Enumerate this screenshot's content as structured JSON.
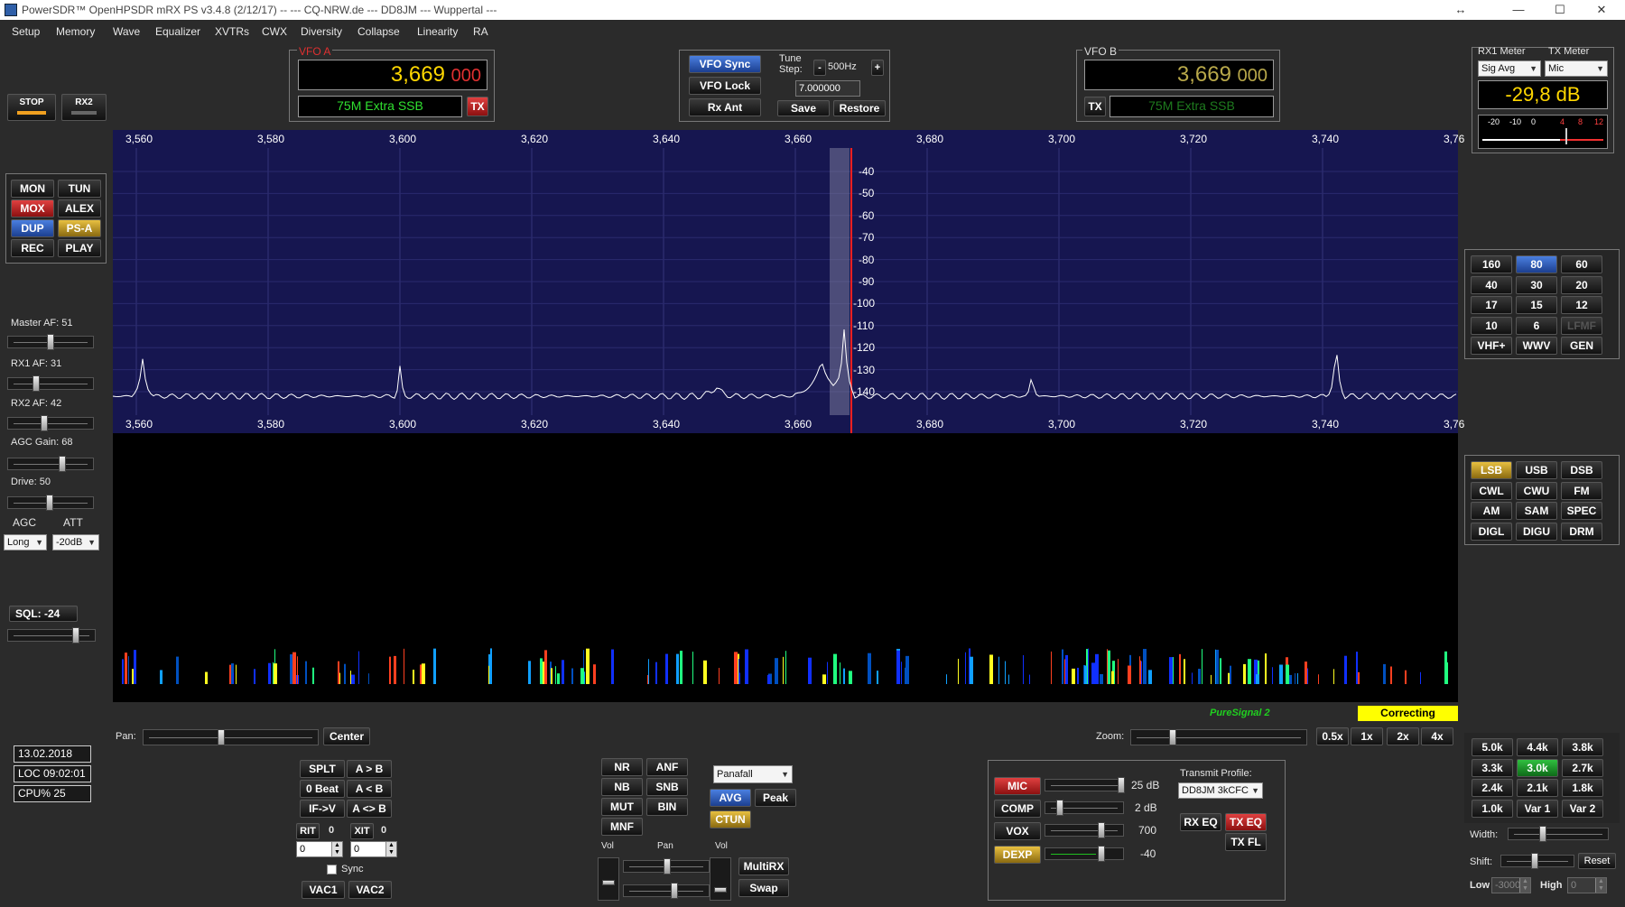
{
  "window": {
    "title": "PowerSDR™ OpenHPSDR mRX PS v3.4.8 (2/12/17)  --  ---  CQ-NRW.de  ---  DD8JM  ---  Wuppertal  ---",
    "restore_icon": "↔",
    "min": "—",
    "max": "☐",
    "close": "✕"
  },
  "menu": [
    "Setup",
    "Memory",
    "Wave",
    "Equalizer",
    "XVTRs",
    "CWX",
    "Diversity",
    "Collapse",
    "Linearity",
    "RA"
  ],
  "power": {
    "stop": "STOP",
    "rx2": "RX2"
  },
  "func_buttons": [
    {
      "label": "MON",
      "style": ""
    },
    {
      "label": "TUN",
      "style": ""
    },
    {
      "label": "MOX",
      "style": "red"
    },
    {
      "label": "ALEX",
      "style": ""
    },
    {
      "label": "DUP",
      "style": "blue"
    },
    {
      "label": "PS-A",
      "style": "gold"
    },
    {
      "label": "REC",
      "style": ""
    },
    {
      "label": "PLAY",
      "style": ""
    }
  ],
  "left": {
    "master_af": "Master AF:  51",
    "rx1_af": "RX1 AF:  31",
    "rx2_af": "RX2 AF:  42",
    "agc_gain": "AGC Gain:  68",
    "drive": "Drive:  50",
    "agc": "AGC",
    "att": "ATT",
    "agc_value": "Long",
    "att_value": "-20dB",
    "sql": "SQL:  -24"
  },
  "levels": {
    "master_af": 51,
    "rx1_af": 31,
    "rx2_af": 42,
    "agc_gain": 68,
    "drive": 50
  },
  "vfoa": {
    "title": "VFO A",
    "freq": "3,669",
    "freq_sub": "000",
    "band": "75M Extra SSB",
    "tx": "TX"
  },
  "vfob": {
    "title": "VFO B",
    "freq": "3,669",
    "freq_sub": "000",
    "band": "75M Extra SSB",
    "tx": "TX"
  },
  "tune": {
    "vfo_sync": "VFO Sync",
    "vfo_lock": "VFO Lock",
    "rx_ant": "Rx Ant",
    "tune_step_label": "Tune Step:",
    "minus": "-",
    "plus": "+",
    "step": "500Hz",
    "freq": "7.000000",
    "save": "Save",
    "restore": "Restore"
  },
  "meter": {
    "rx1_label": "RX1 Meter",
    "tx_label": "TX Meter",
    "rx1_mode": "Sig Avg",
    "tx_mode": "Mic",
    "value": "-29,8 dB",
    "scale": [
      "-20",
      "-10",
      "0",
      "4",
      "8",
      "12"
    ]
  },
  "spectrum": {
    "freq_labels": [
      "3,560",
      "3,580",
      "3,600",
      "3,620",
      "3,640",
      "3,660",
      "3,680",
      "3,700",
      "3,720",
      "3,740",
      "3,76"
    ],
    "db_labels": [
      "-40",
      "-50",
      "-60",
      "-70",
      "-80",
      "-90",
      "-100",
      "-110",
      "-120",
      "-130",
      "-140"
    ]
  },
  "waterfall": {
    "puresignal": "PureSignal 2",
    "correcting": "Correcting"
  },
  "bands": [
    "160",
    "80",
    "60",
    "40",
    "30",
    "20",
    "17",
    "15",
    "12",
    "10",
    "6",
    "LFMF",
    "VHF+",
    "WWV",
    "GEN"
  ],
  "modes": [
    "LSB",
    "USB",
    "DSB",
    "CWL",
    "CWU",
    "FM",
    "AM",
    "SAM",
    "SPEC",
    "DIGL",
    "DIGU",
    "DRM"
  ],
  "filters": [
    "5.0k",
    "4.4k",
    "3.8k",
    "3.3k",
    "3.0k",
    "2.7k",
    "2.4k",
    "2.1k",
    "1.8k",
    "1.0k",
    "Var 1",
    "Var 2"
  ],
  "filter_ctrl": {
    "width": "Width:",
    "shift": "Shift:",
    "reset": "Reset",
    "low": "Low",
    "low_val": "-3000",
    "high": "High",
    "high_val": "0"
  },
  "pan": {
    "pan": "Pan:",
    "center": "Center",
    "zoom": "Zoom:",
    "zooms": [
      "0.5x",
      "1x",
      "2x",
      "4x"
    ]
  },
  "status": {
    "date": "13.02.2018",
    "time": "LOC 09:02:01",
    "cpu": "CPU%  25"
  },
  "split": {
    "splt": "SPLT",
    "a2b": "A > B",
    "zero_beat": "0 Beat",
    "b2a": "A < B",
    "if_v": "IF->V",
    "swap": "A <> B",
    "rit": "RIT",
    "rit_v": "0",
    "xit": "XIT",
    "xit_v": "0",
    "rit_val": "0",
    "xit_val": "0",
    "sync": "Sync",
    "vac1": "VAC1",
    "vac2": "VAC2"
  },
  "dsp": {
    "buttons": [
      "NR",
      "ANF",
      "NB",
      "SNB",
      "MUT",
      "BIN",
      "MNF"
    ],
    "display": "Panafall",
    "avg": "AVG",
    "peak": "Peak",
    "ctun": "CTUN",
    "vol": "Vol",
    "pan": "Pan",
    "vol2": "Vol",
    "multirx": "MultiRX",
    "swap": "Swap"
  },
  "tx": {
    "mic": "MIC",
    "mic_v": "25 dB",
    "comp": "COMP",
    "comp_v": "2 dB",
    "vox": "VOX",
    "vox_v": "700",
    "dexp": "DEXP",
    "dexp_v": "-40",
    "profile_label": "Transmit Profile:",
    "profile": "DD8JM 3kCFC",
    "rx_eq": "RX EQ",
    "tx_eq": "TX EQ",
    "tx_fl": "TX FL"
  }
}
